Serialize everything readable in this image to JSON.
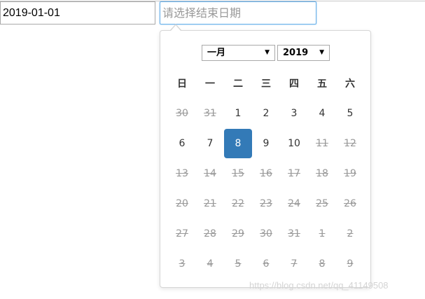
{
  "start_input": {
    "value": "2019-01-01"
  },
  "end_input": {
    "value": "",
    "placeholder": "请选择结束日期"
  },
  "picker": {
    "month_select": "一月",
    "year_select": "2019",
    "weekdays": [
      "日",
      "一",
      "二",
      "三",
      "四",
      "五",
      "六"
    ],
    "weeks": [
      [
        {
          "d": "30",
          "disabled": true
        },
        {
          "d": "31",
          "disabled": true
        },
        {
          "d": "1"
        },
        {
          "d": "2"
        },
        {
          "d": "3"
        },
        {
          "d": "4"
        },
        {
          "d": "5"
        }
      ],
      [
        {
          "d": "6"
        },
        {
          "d": "7"
        },
        {
          "d": "8",
          "selected": true
        },
        {
          "d": "9"
        },
        {
          "d": "10"
        },
        {
          "d": "11",
          "disabled": true
        },
        {
          "d": "12",
          "disabled": true
        }
      ],
      [
        {
          "d": "13",
          "disabled": true
        },
        {
          "d": "14",
          "disabled": true
        },
        {
          "d": "15",
          "disabled": true
        },
        {
          "d": "16",
          "disabled": true
        },
        {
          "d": "17",
          "disabled": true
        },
        {
          "d": "18",
          "disabled": true
        },
        {
          "d": "19",
          "disabled": true
        }
      ],
      [
        {
          "d": "20",
          "disabled": true
        },
        {
          "d": "21",
          "disabled": true
        },
        {
          "d": "22",
          "disabled": true
        },
        {
          "d": "23",
          "disabled": true
        },
        {
          "d": "24",
          "disabled": true
        },
        {
          "d": "25",
          "disabled": true
        },
        {
          "d": "26",
          "disabled": true
        }
      ],
      [
        {
          "d": "27",
          "disabled": true
        },
        {
          "d": "28",
          "disabled": true
        },
        {
          "d": "29",
          "disabled": true
        },
        {
          "d": "30",
          "disabled": true
        },
        {
          "d": "31",
          "disabled": true
        },
        {
          "d": "1",
          "disabled": true
        },
        {
          "d": "2",
          "disabled": true
        }
      ],
      [
        {
          "d": "3",
          "disabled": true
        },
        {
          "d": "4",
          "disabled": true
        },
        {
          "d": "5",
          "disabled": true
        },
        {
          "d": "6",
          "disabled": true
        },
        {
          "d": "7",
          "disabled": true
        },
        {
          "d": "8",
          "disabled": true
        },
        {
          "d": "9",
          "disabled": true
        }
      ]
    ]
  },
  "watermark": "https://blog.csdn.net/qq_41149508",
  "colors": {
    "selected_bg": "#337ab7",
    "focus_border": "#66afe9",
    "disabled_text": "#999999"
  }
}
